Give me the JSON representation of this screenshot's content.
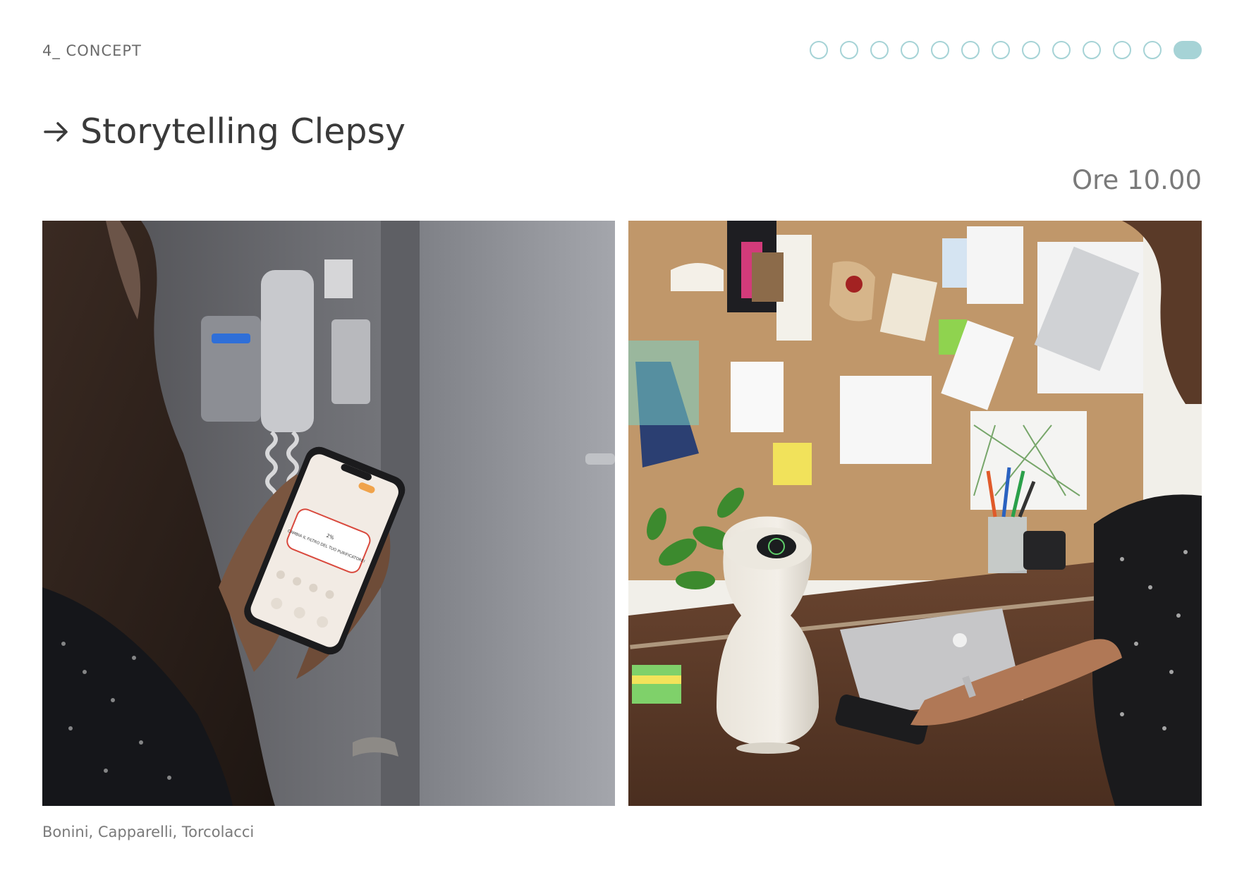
{
  "header": {
    "section_label": "4_ CONCEPT",
    "progress": {
      "total_steps": 13,
      "current_step": 13
    }
  },
  "slide": {
    "title": "Storytelling Clepsy",
    "time_label": "Ore 10.00"
  },
  "photos": [
    {
      "id": "left",
      "subject": "woman-holding-smartphone-with-app"
    },
    {
      "id": "right",
      "subject": "air-purifier-on-desk-with-corkboard"
    }
  ],
  "phone_screen": {
    "alert_text": "CAMBIA IL FILTRO DEL TUO PURIFICATORE!",
    "percent": "2%"
  },
  "footer": {
    "credit": "Bonini, Capparelli, Torcolacci"
  },
  "colors": {
    "accent": "#a6d3d6",
    "title": "#3a3a3a",
    "muted": "#7a7a7a"
  }
}
